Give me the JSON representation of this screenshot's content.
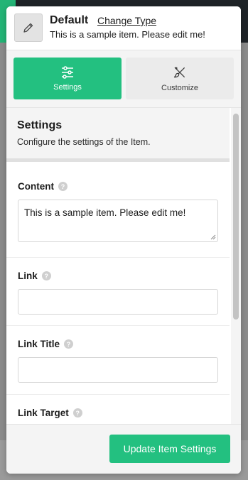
{
  "header": {
    "item_name": "Default",
    "change_type_label": "Change Type",
    "item_description": "This is a sample item. Please edit me!",
    "type_icon": "pencil-icon"
  },
  "tabs": [
    {
      "label": "Settings",
      "icon": "sliders-icon",
      "active": true
    },
    {
      "label": "Customize",
      "icon": "brush-icon",
      "active": false
    }
  ],
  "panel": {
    "title": "Settings",
    "subtitle": "Configure the settings of the Item."
  },
  "fields": {
    "content": {
      "label": "Content",
      "value": "This is a sample item. Please edit me!"
    },
    "link": {
      "label": "Link",
      "value": ""
    },
    "link_title": {
      "label": "Link Title",
      "value": ""
    },
    "link_target": {
      "label": "Link Target",
      "value": ""
    }
  },
  "help_glyph": "?",
  "footer": {
    "update_label": "Update Item Settings"
  },
  "colors": {
    "accent": "#23c080",
    "dark_bar": "#1e2327"
  }
}
